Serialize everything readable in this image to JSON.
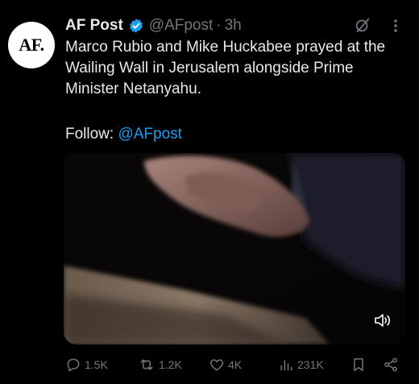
{
  "tweet": {
    "avatar_text": "AF.",
    "author_name": "AF Post",
    "handle": "@AFpost",
    "separator": "·",
    "time": "3h",
    "text": "Marco Rubio and Mike Huckabee prayed at the Wailing Wall in Jerusalem alongside Prime Minister Netanyahu.",
    "follow_label": "Follow: ",
    "follow_mention": "@AFpost"
  },
  "actions": {
    "replies": "1.5K",
    "reposts": "1.2K",
    "likes": "4K",
    "views": "231K"
  },
  "colors": {
    "background": "#000000",
    "text": "#e7e9ea",
    "muted": "#71767b",
    "accent": "#1d9bf0"
  }
}
